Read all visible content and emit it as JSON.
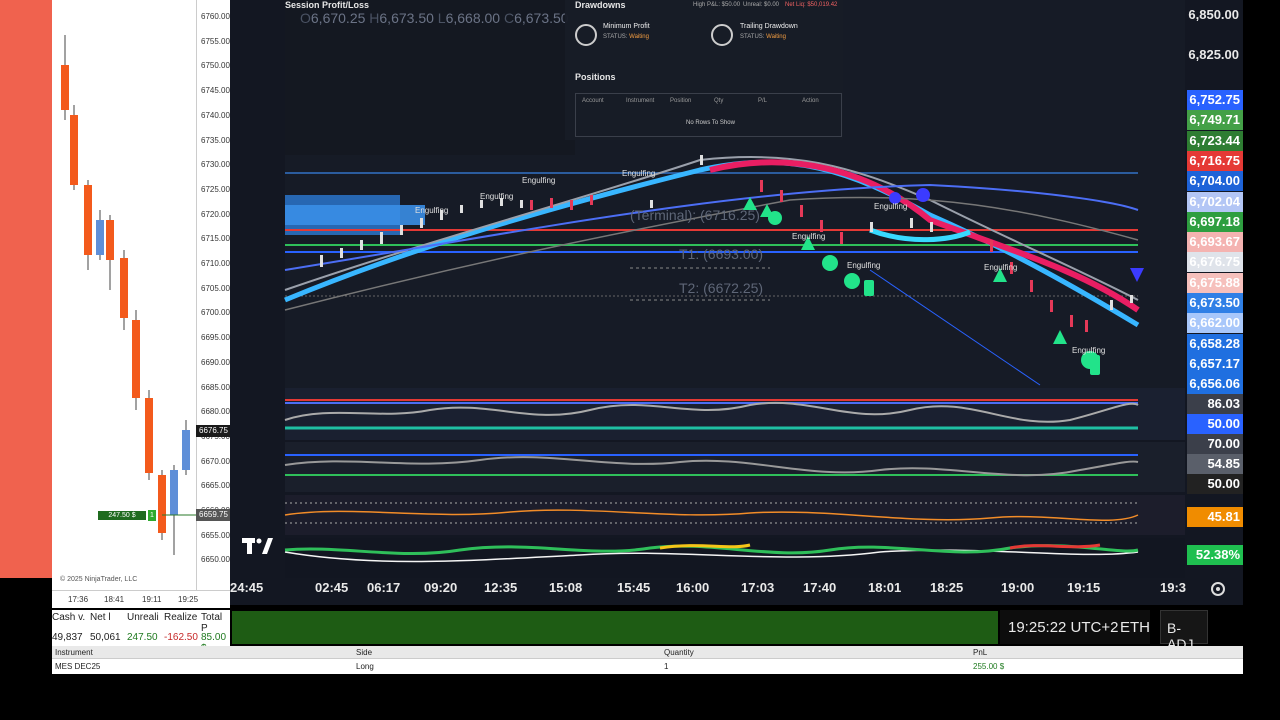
{
  "ninjatrader": {
    "price_axis": [
      "6760.00",
      "6755.00",
      "6750.00",
      "6745.00",
      "6740.00",
      "6735.00",
      "6730.00",
      "6725.00",
      "6720.00",
      "6715.00",
      "6710.00",
      "6705.00",
      "6700.00",
      "6695.00",
      "6690.00",
      "6685.00",
      "6680.00",
      "6675.00",
      "6670.00",
      "6665.00",
      "6660.00",
      "6655.00",
      "6650.00"
    ],
    "last_price_tag": "6676.75",
    "position_tag": "6659.75",
    "pnl_tag": "247.50 $",
    "qty_tag": "1",
    "time_axis": [
      "17:36",
      "18:41",
      "19:11",
      "19:25"
    ],
    "copyright": "© 2025 NinjaTrader, LLC",
    "account": {
      "headers": [
        "Cash v.",
        "Net l",
        "Unreali",
        "Realize",
        "Total P"
      ],
      "values": [
        "49,837",
        "50,061",
        "247.50",
        "-162.50",
        "85.00 $"
      ]
    },
    "positions_table": {
      "headers": [
        "Instrument",
        "Side",
        "Quantity",
        "PnL"
      ],
      "row": [
        "MES DEC25",
        "Long",
        "1",
        "255.00 $"
      ]
    }
  },
  "overlay": {
    "session_title": "Session Profit/Loss",
    "ohlc": {
      "o": "6,670.25",
      "h": "6,673.50",
      "l": "6,668.00",
      "c": "6,673.50"
    },
    "drawdowns": {
      "title": "Drawdowns",
      "high_pnl": "High P&L: $50.00",
      "unreal": "Unreal: $0.00",
      "net_liq": "Net Liq: $50,019.42",
      "min_profit_label": "Minimum Profit",
      "trailing_label": "Trailing Drawdown",
      "status_label": "STATUS:",
      "status_value": "Waiting"
    },
    "positions": {
      "title": "Positions",
      "headers": [
        "Account",
        "Instrument",
        "Position",
        "Qty",
        "P/L",
        "Action"
      ],
      "empty": "No Rows To Show"
    }
  },
  "tv": {
    "labels": {
      "terminal": "(Terminal): (6716.25)",
      "t1": "T1: (6693.00)",
      "t2": "T2: (6672.25)",
      "engulfing": "Engulfing"
    },
    "price_axis_top": [
      "6,850.00",
      "6,825.00"
    ],
    "price_tags": [
      {
        "v": "6,752.75",
        "bg": "#2962ff"
      },
      {
        "v": "6,749.71",
        "bg": "#43a047"
      },
      {
        "v": "6,723.44",
        "bg": "#2e7d32"
      },
      {
        "v": "6,716.75",
        "bg": "#e53935"
      },
      {
        "v": "6,704.00",
        "bg": "#1e63d8"
      },
      {
        "v": "6,702.04",
        "bg": "#b3c6f5"
      },
      {
        "v": "6,697.18",
        "bg": "#2e9e40"
      },
      {
        "v": "6,693.67",
        "bg": "#f4b3b1"
      },
      {
        "v": "6,676.75",
        "bg": "#dfe3ea"
      },
      {
        "v": "6,675.88",
        "bg": "#f6c0bc"
      },
      {
        "v": "6,673.50",
        "bg": "#2f7fe6"
      },
      {
        "v": "6,662.00",
        "bg": "#a8c7fa"
      },
      {
        "v": "6,658.28",
        "bg": "#1f6fe0"
      },
      {
        "v": "6,657.17",
        "bg": "#1f6fe0"
      },
      {
        "v": "6,656.06",
        "bg": "#1f6fe0"
      }
    ],
    "indicator_tags": [
      {
        "v": "86.03",
        "bg": "#3b3f4a"
      },
      {
        "v": "50.00",
        "bg": "#2962ff"
      },
      {
        "v": "70.00",
        "bg": "#3b3f4a"
      },
      {
        "v": "54.85",
        "bg": "#5a5f6a"
      },
      {
        "v": "50.00",
        "bg": "#222"
      },
      {
        "v": "45.81",
        "bg": "#f08c00"
      },
      {
        "v": "52.38%",
        "bg": "#1fbf50"
      }
    ],
    "time_axis": [
      "24:45",
      "02:45",
      "06:17",
      "09:20",
      "12:35",
      "15:08",
      "15:45",
      "16:00",
      "17:03",
      "17:40",
      "18:01",
      "18:25",
      "19:00",
      "19:15",
      "19:3"
    ],
    "clock": "19:25:22 UTC+2",
    "session": "ETH",
    "adjust": "B-ADJ"
  }
}
